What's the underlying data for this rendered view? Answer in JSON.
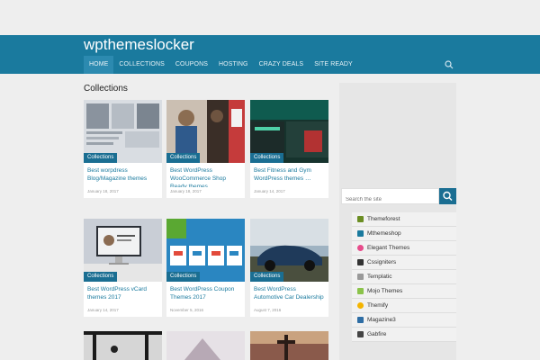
{
  "site": {
    "title": "wpthemeslocker"
  },
  "nav": [
    {
      "label": "HOME"
    },
    {
      "label": "COLLECTIONS"
    },
    {
      "label": "COUPONS"
    },
    {
      "label": "HOSTING"
    },
    {
      "label": "CRAZY DEALS"
    },
    {
      "label": "SITE READY"
    }
  ],
  "main": {
    "heading": "Collections",
    "cards": [
      {
        "badge": "Collections",
        "title": "Best worpdress Blog/Magazine themes",
        "date": "January 18, 2017"
      },
      {
        "badge": "Collections",
        "title": "Best WordPress WooCommerce Shop Ready themes …",
        "date": "January 18, 2017"
      },
      {
        "badge": "Collections",
        "title": "Best Fitness and Gym WordPress themes …",
        "date": "January 14, 2017"
      },
      {
        "badge": "Collections",
        "title": "Best WordPress vCard themes 2017",
        "date": "January 14, 2017"
      },
      {
        "badge": "Collections",
        "title": "Best WordPress Coupon Themes 2017",
        "date": "November 5, 2016"
      },
      {
        "badge": "Collections",
        "title": "Best WordPress Automotive Car Dealership …",
        "date": "August 7, 2016"
      }
    ]
  },
  "sidebar": {
    "search_placeholder": "Search the site",
    "links": [
      {
        "label": "Themeforest",
        "color": "#6b8e23"
      },
      {
        "label": "Mthemeshop",
        "color": "#1a7a9e"
      },
      {
        "label": "Elegant Themes",
        "color": "#e74c8b"
      },
      {
        "label": "Cssigniters",
        "color": "#333333"
      },
      {
        "label": "Templatic",
        "color": "#999999"
      },
      {
        "label": "Mojo Themes",
        "color": "#8bc34a"
      },
      {
        "label": "Themify",
        "color": "#f4b400"
      },
      {
        "label": "Magazine3",
        "color": "#2e6da4"
      },
      {
        "label": "Gabfire",
        "color": "#444444"
      }
    ]
  }
}
